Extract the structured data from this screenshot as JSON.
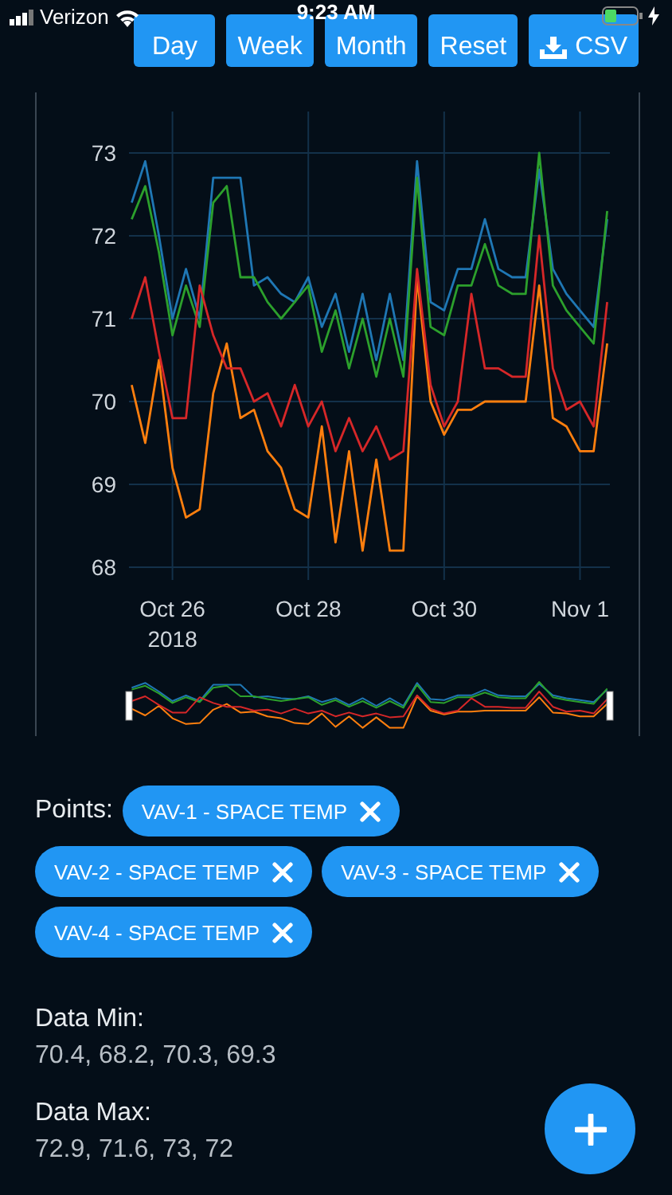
{
  "status_bar": {
    "carrier": "Verizon",
    "time": "9:23 AM"
  },
  "toolbar": {
    "buttons": [
      {
        "label": "Day",
        "kind": "text"
      },
      {
        "label": "Week",
        "kind": "text"
      },
      {
        "label": "Month",
        "kind": "text"
      },
      {
        "label": "Reset",
        "kind": "text"
      },
      {
        "label": "CSV",
        "kind": "download"
      }
    ]
  },
  "chart": {
    "chart_data": {
      "type": "line",
      "categories": [
        null,
        null,
        null,
        "Oct 26\n2018",
        null,
        null,
        null,
        null,
        null,
        null,
        null,
        null,
        null,
        "Oct 28",
        null,
        null,
        null,
        null,
        null,
        null,
        null,
        null,
        null,
        "Oct 30",
        null,
        null,
        null,
        null,
        null,
        null,
        null,
        null,
        null,
        "Nov 1",
        null,
        null
      ],
      "series": [
        {
          "color": "#1f77b4",
          "values": [
            72.4,
            72.9,
            72.0,
            71.0,
            71.6,
            71.0,
            72.7,
            72.7,
            72.7,
            71.4,
            71.5,
            71.3,
            71.2,
            71.5,
            70.9,
            71.3,
            70.6,
            71.3,
            70.5,
            71.3,
            70.5,
            72.9,
            71.2,
            71.1,
            71.6,
            71.6,
            72.2,
            71.6,
            71.5,
            71.5,
            72.8,
            71.6,
            71.3,
            71.1,
            70.9,
            72.2
          ]
        },
        {
          "color": "#ff7f0e",
          "values": [
            70.2,
            69.5,
            70.5,
            69.2,
            68.6,
            68.7,
            70.1,
            70.7,
            69.8,
            69.9,
            69.4,
            69.2,
            68.7,
            68.6,
            69.7,
            68.3,
            69.4,
            68.2,
            69.3,
            68.2,
            68.2,
            71.5,
            70.0,
            69.6,
            69.9,
            69.9,
            70.0,
            70.0,
            70.0,
            70.0,
            71.4,
            69.8,
            69.7,
            69.4,
            69.4,
            70.7
          ]
        },
        {
          "color": "#2ca02c",
          "values": [
            72.2,
            72.6,
            71.8,
            70.8,
            71.4,
            70.9,
            72.4,
            72.6,
            71.5,
            71.5,
            71.2,
            71.0,
            71.2,
            71.4,
            70.6,
            71.1,
            70.4,
            71.0,
            70.3,
            71.0,
            70.3,
            72.7,
            70.9,
            70.8,
            71.4,
            71.4,
            71.9,
            71.4,
            71.3,
            71.3,
            73.0,
            71.4,
            71.1,
            70.9,
            70.7,
            72.3
          ]
        },
        {
          "color": "#d62728",
          "values": [
            71.0,
            71.5,
            70.6,
            69.8,
            69.8,
            71.4,
            70.8,
            70.4,
            70.4,
            70.0,
            70.1,
            69.7,
            70.2,
            69.7,
            70.0,
            69.4,
            69.8,
            69.4,
            69.7,
            69.3,
            69.4,
            71.6,
            70.2,
            69.7,
            70.0,
            71.3,
            70.4,
            70.4,
            70.3,
            70.3,
            72.0,
            70.4,
            69.9,
            70.0,
            69.7,
            71.2
          ]
        }
      ],
      "grid": true,
      "ylim": [
        68,
        73
      ],
      "yticks": [
        68,
        69,
        70,
        71,
        72,
        73
      ]
    }
  },
  "points": {
    "label": "Points:",
    "chips": [
      {
        "label": "VAV-1 - SPACE TEMP"
      },
      {
        "label": "VAV-2 - SPACE TEMP"
      },
      {
        "label": "VAV-3 - SPACE TEMP"
      },
      {
        "label": "VAV-4 - SPACE TEMP"
      }
    ]
  },
  "stats": [
    {
      "label": "Data Min:",
      "value": "70.4, 68.2, 70.3, 69.3"
    },
    {
      "label": "Data Max:",
      "value": "72.9, 71.6, 73, 72"
    }
  ]
}
